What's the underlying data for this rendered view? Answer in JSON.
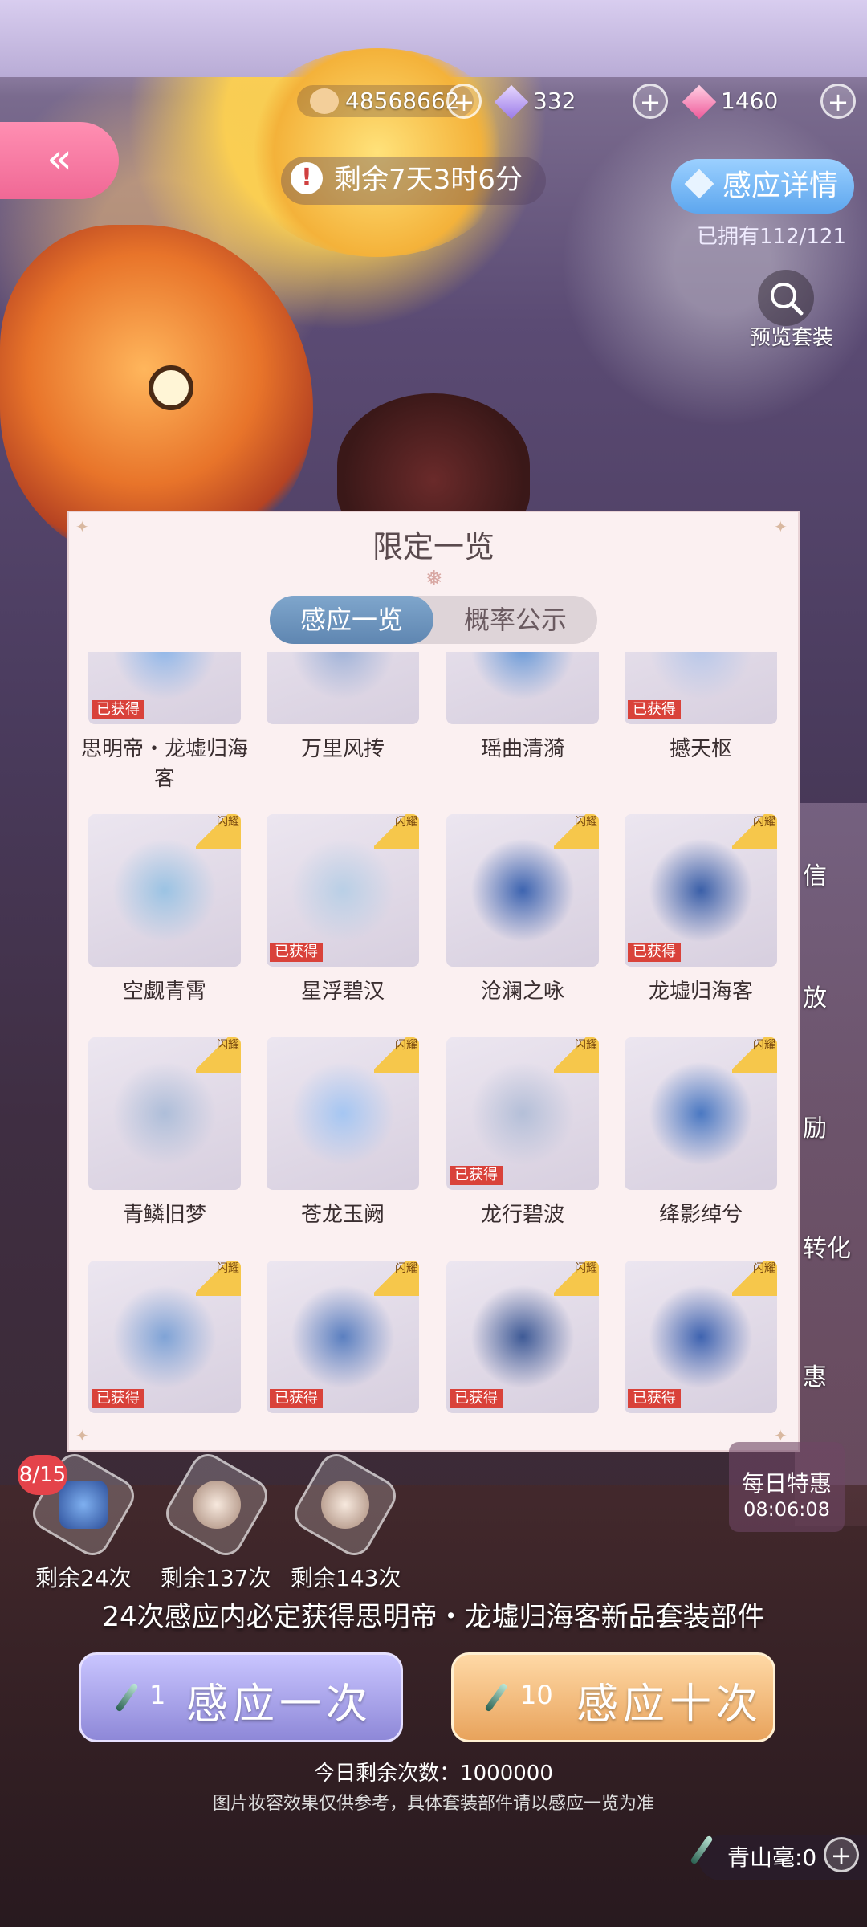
{
  "currency": {
    "coins": "48568662",
    "diamonds_blue": "332",
    "diamonds_pink": "1460",
    "plus": "+"
  },
  "header": {
    "back": "«",
    "timer": "剩余7天3时6分",
    "warn": "!",
    "detail_button": "感应详情",
    "owned": "已拥有112/121",
    "preview": "预览套装"
  },
  "modal": {
    "title": "限定一览",
    "tabs": [
      "感应一览",
      "概率公示"
    ],
    "badge_text": "闪耀",
    "owned_tag": "已获得",
    "items": [
      {
        "name": "思明帝・龙墟归海客",
        "owned": true,
        "badge": false
      },
      {
        "name": "万里风抟",
        "owned": false,
        "badge": false
      },
      {
        "name": "瑶曲清漪",
        "owned": false,
        "badge": false
      },
      {
        "name": "撼天枢",
        "owned": true,
        "badge": false
      },
      {
        "name": "空觑青霄",
        "owned": false,
        "badge": true
      },
      {
        "name": "星浮碧汉",
        "owned": true,
        "badge": true
      },
      {
        "name": "沧澜之咏",
        "owned": false,
        "badge": true
      },
      {
        "name": "龙墟归海客",
        "owned": true,
        "badge": true
      },
      {
        "name": "青鳞旧梦",
        "owned": false,
        "badge": true
      },
      {
        "name": "苍龙玉阙",
        "owned": false,
        "badge": true
      },
      {
        "name": "龙行碧波",
        "owned": true,
        "badge": true
      },
      {
        "name": "绛影绰兮",
        "owned": false,
        "badge": true
      },
      {
        "name": "",
        "owned": true,
        "badge": true
      },
      {
        "name": "",
        "owned": true,
        "badge": true
      },
      {
        "name": "",
        "owned": true,
        "badge": true
      },
      {
        "name": "",
        "owned": true,
        "badge": true
      }
    ]
  },
  "pity": {
    "count_badge": "8/15",
    "remaining": [
      "剩余24次",
      "剩余137次",
      "剩余143次"
    ],
    "guarantee": "24次感应内必定获得思明帝・龙墟归海客新品套装部件"
  },
  "draw": {
    "one_count": "1",
    "one_label": "感应一次",
    "ten_count": "10",
    "ten_label": "感应十次",
    "today": "今日剩余次数：1000000",
    "note": "图片妆容效果仅供参考，具体套装部件请以感应一览为准"
  },
  "daily": {
    "title": "每日特惠",
    "time": "08:06:08"
  },
  "side_labels": [
    "信",
    "放",
    "励",
    "转化",
    "惠"
  ],
  "qingshan": "青山毫:0",
  "colors": {
    "accent_pink": "#f06895",
    "accent_blue": "#5da6ee",
    "owned_red": "#d9423a",
    "badge_gold": "#f6c74b"
  }
}
